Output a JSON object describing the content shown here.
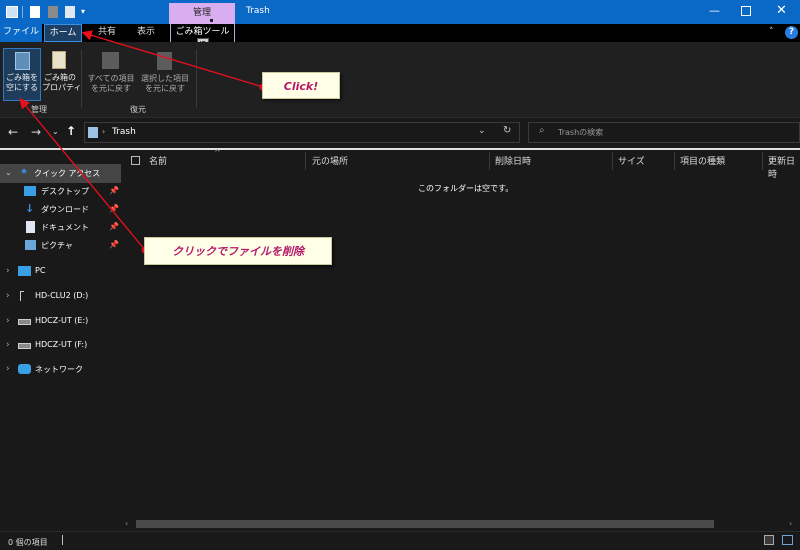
{
  "window": {
    "title": "Trash",
    "ctx_tab_label": "管理"
  },
  "ribbon_tabs": {
    "file": "ファイル",
    "home": "ホーム",
    "share": "共有",
    "view": "表示",
    "tools": "ごみ箱ツール",
    "keytip": "JR"
  },
  "ribbon": {
    "empty_recycle_label": "ごみ箱を\n空にする",
    "recycle_props_label": "ごみ箱の\nプロパティ",
    "restore_all_label": "すべての項目\nを元に戻す",
    "restore_selected_label": "選択した項目\nを元に戻す",
    "group_manage": "管理",
    "group_restore": "復元"
  },
  "address": {
    "path": "Trash",
    "search_placeholder": "Trashの検索"
  },
  "nav": {
    "quick_access": "クイック アクセス",
    "items": [
      "デスクトップ",
      "ダウンロード",
      "ドキュメント",
      "ピクチャ"
    ],
    "pc": "PC",
    "drives": [
      "HD-CLU2 (D:)",
      "HDCZ-UT (E:)",
      "HDCZ-UT (F:)"
    ],
    "network": "ネットワーク"
  },
  "columns": [
    "名前",
    "元の場所",
    "削除日時",
    "サイズ",
    "項目の種類",
    "更新日時"
  ],
  "empty_message": "このフォルダーは空です。",
  "status": {
    "count": "0 個の項目"
  },
  "annotations": {
    "click": "Click!",
    "delete": "クリックでファイルを削除"
  },
  "colors": {
    "titlebar": "#0a68c7",
    "context_tab": "#d9aef0",
    "callout_text": "#b5196b",
    "arrow": "#e8101c"
  }
}
